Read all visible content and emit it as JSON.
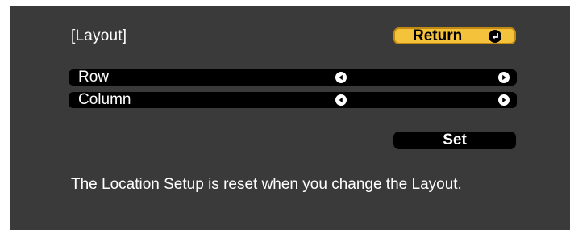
{
  "dialog": {
    "title": "[Layout]",
    "return_button": {
      "label": "Return",
      "icon": "enter-icon"
    },
    "rows": [
      {
        "label": "Row",
        "left_icon": "arrow-left-icon",
        "right_icon": "arrow-right-icon"
      },
      {
        "label": "Column",
        "left_icon": "arrow-left-icon",
        "right_icon": "arrow-right-icon"
      }
    ],
    "set_button": {
      "label": "Set"
    },
    "message": "The Location Setup is reset when you change the Layout."
  },
  "colors": {
    "background": "#3a3a3a",
    "highlight": "#f5c23c",
    "row_background": "#000000",
    "text": "#ffffff"
  }
}
